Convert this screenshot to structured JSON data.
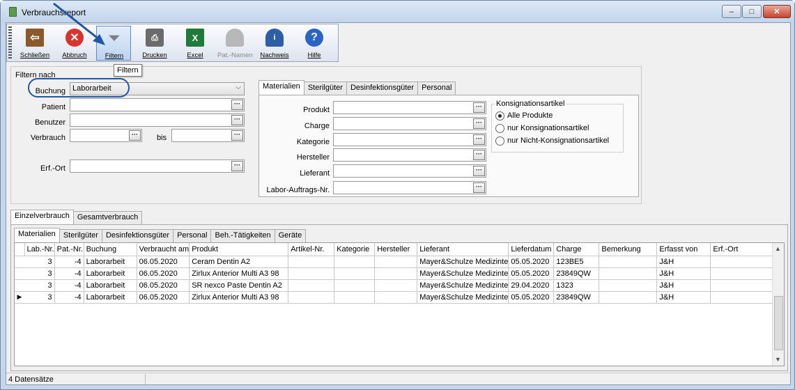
{
  "window": {
    "title": "Verbrauchsreport",
    "controls": {
      "minimize": "–",
      "maximize": "□",
      "close": "✕"
    }
  },
  "toolbar": {
    "buttons": [
      {
        "label": "Schließen",
        "icon": "door-exit-icon",
        "color": "#8a5a2a"
      },
      {
        "label": "Abbruch",
        "icon": "cancel-x-icon",
        "color": "#d9342b"
      },
      {
        "label": "Filtern",
        "icon": "funnel-filter-icon",
        "color": "#9aa0a8"
      },
      {
        "label": "Drucken",
        "icon": "printer-icon",
        "color": "#6b6b6b"
      },
      {
        "label": "Excel",
        "icon": "excel-icon",
        "color": "#1e7b3a"
      },
      {
        "label": "Pat.-Namen",
        "icon": "patient-icon",
        "color": "#a9a9a9"
      },
      {
        "label": "Nachweis",
        "icon": "user-info-icon",
        "color": "#2d5fa8"
      },
      {
        "label": "Hilfe",
        "icon": "help-icon",
        "color": "#2a64c4"
      }
    ],
    "tooltip": "Filtern"
  },
  "filter": {
    "legend": "Filtern nach",
    "buchung": {
      "label": "Buchung",
      "value": "Laborarbeit"
    },
    "patient": {
      "label": "Patient",
      "value": ""
    },
    "benutzer": {
      "label": "Benutzer",
      "value": ""
    },
    "verbrauch": {
      "label": "Verbrauch",
      "bis": "bis",
      "from": "",
      "to": ""
    },
    "erfort": {
      "label": "Erf.-Ort",
      "value": ""
    }
  },
  "material_tabs": [
    "Materialien",
    "Sterilgüter",
    "Desinfektionsgüter",
    "Personal"
  ],
  "material_fields": {
    "produkt": "Produkt",
    "charge": "Charge",
    "kategorie": "Kategorie",
    "hersteller": "Hersteller",
    "lieferant": "Lieferant",
    "labor": "Labor-Auftrags-Nr."
  },
  "konsignation": {
    "legend": "Konsignationsartikel",
    "options": [
      "Alle Produkte",
      "nur Konsignationsartikel",
      "nur Nicht-Konsignationsartikel"
    ],
    "selected": 0
  },
  "lower_tabs": [
    "Einzelverbrauch",
    "Gesamtverbrauch"
  ],
  "grid_tabs": [
    "Materialien",
    "Sterilgüter",
    "Desinfektionsgüter",
    "Personal",
    "Beh.-Tätigkeiten",
    "Geräte"
  ],
  "table": {
    "columns": [
      "Lab.-Nr.",
      "Pat.-Nr.",
      "Buchung",
      "Verbraucht am",
      "Produkt",
      "Artikel-Nr.",
      "Kategorie",
      "Hersteller",
      "Lieferant",
      "Lieferdatum",
      "Charge",
      "Bemerkung",
      "Erfasst von",
      "Erf.-Ort"
    ],
    "rows": [
      [
        "3",
        "-4",
        "Laborarbeit",
        "06.05.2020",
        "Ceram Dentin A2",
        "",
        "",
        "",
        "Mayer&Schulze Medizinte",
        "05.05.2020",
        "123BE5",
        "",
        "J&H",
        ""
      ],
      [
        "3",
        "-4",
        "Laborarbeit",
        "06.05.2020",
        "Zirlux Anterior Multi A3 98",
        "",
        "",
        "",
        "Mayer&Schulze Medizinte",
        "05.05.2020",
        "23849QW",
        "",
        "J&H",
        ""
      ],
      [
        "3",
        "-4",
        "Laborarbeit",
        "06.05.2020",
        "SR nexco Paste Dentin A2",
        "",
        "",
        "",
        "Mayer&Schulze Medizinte",
        "29.04.2020",
        "1323",
        "",
        "J&H",
        ""
      ],
      [
        "3",
        "-4",
        "Laborarbeit",
        "06.05.2020",
        "Zirlux Anterior Multi A3 98",
        "",
        "",
        "",
        "Mayer&Schulze Medizinte",
        "05.05.2020",
        "23849QW",
        "",
        "J&H",
        ""
      ]
    ],
    "current_row_marker": "▶"
  },
  "status": {
    "text": "4 Datensätze"
  },
  "ellipsis": "···",
  "dropdown_arrow": "⌵"
}
